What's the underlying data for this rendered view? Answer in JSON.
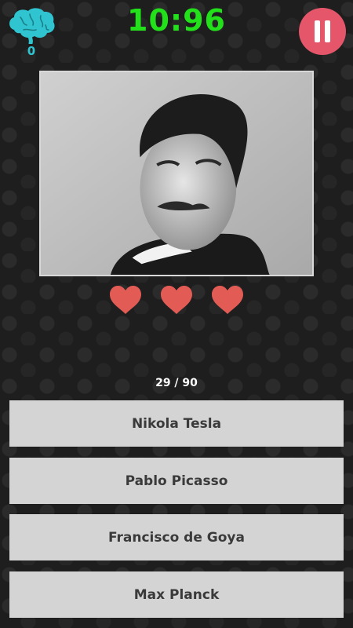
{
  "header": {
    "score": "0",
    "timer": "10:96",
    "brain_icon": "brain-icon",
    "pause_icon": "pause-icon"
  },
  "question": {
    "image_icon": "portrait-photo",
    "lives_remaining": 3,
    "lives_total": 3,
    "progress": "29 / 90"
  },
  "answers": [
    {
      "label": "Nikola Tesla"
    },
    {
      "label": "Pablo Picasso"
    },
    {
      "label": "Francisco de Goya"
    },
    {
      "label": "Max Planck"
    }
  ],
  "colors": {
    "timer": "#22e01a",
    "score": "#2fc4d0",
    "pause_button": "#e5566a",
    "heart": "#e35b55",
    "answer_bg": "#d4d4d4"
  }
}
